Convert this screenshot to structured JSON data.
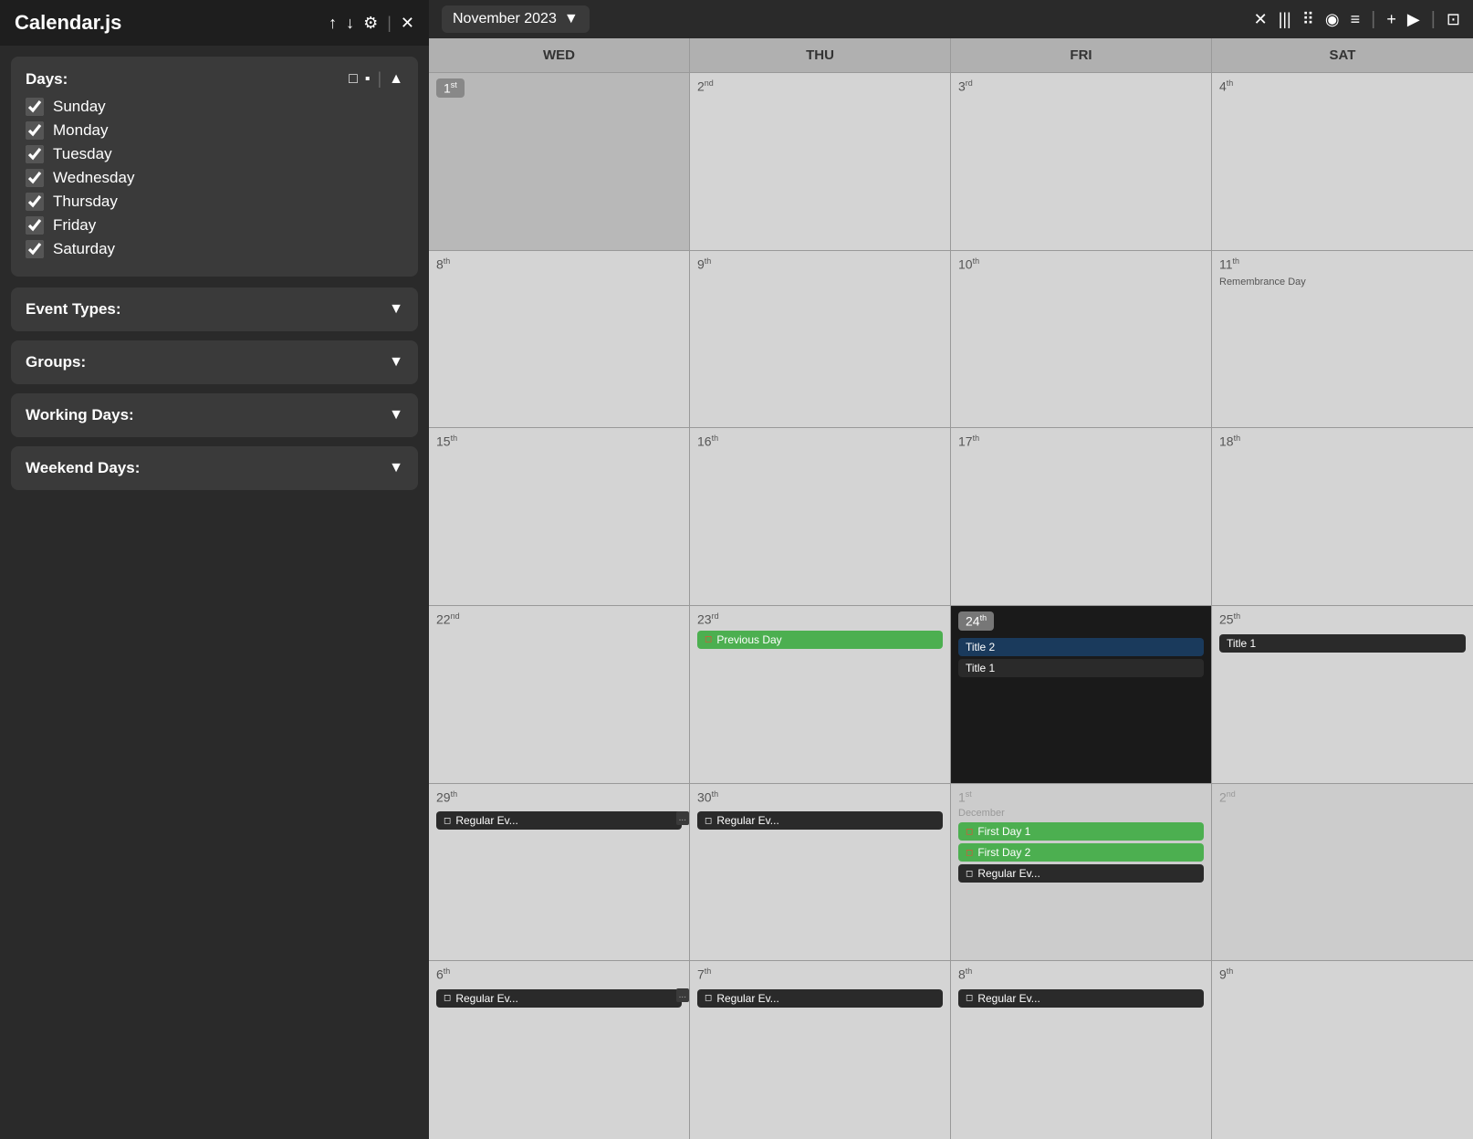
{
  "sidebar": {
    "title": "Calendar.js",
    "header_icons": [
      "↑",
      "↓",
      "⚙",
      "×"
    ],
    "days_label": "Days:",
    "days_view_icons": [
      "□",
      "▪",
      "▲"
    ],
    "days": [
      {
        "label": "Sunday",
        "checked": true
      },
      {
        "label": "Monday",
        "checked": true
      },
      {
        "label": "Tuesday",
        "checked": true
      },
      {
        "label": "Wednesday",
        "checked": true
      },
      {
        "label": "Thursday",
        "checked": true
      },
      {
        "label": "Friday",
        "checked": true
      },
      {
        "label": "Saturday",
        "checked": true
      }
    ],
    "collapsibles": [
      {
        "label": "Event Types:"
      },
      {
        "label": "Groups:"
      },
      {
        "label": "Working Days:"
      },
      {
        "label": "Weekend Days:"
      }
    ]
  },
  "toolbar": {
    "month_label": "November 2023",
    "month_dropdown": "▼",
    "icons": [
      "✕",
      "|||",
      "⠿",
      "◉",
      "≡",
      "|",
      "+",
      "▶",
      "|",
      "⊡"
    ]
  },
  "calendar": {
    "day_headers": [
      "WED",
      "THU",
      "FRI",
      "SAT"
    ],
    "rows": [
      {
        "cells": [
          {
            "date": "1",
            "sup": "st",
            "today_style": true,
            "other_month": false,
            "events": []
          },
          {
            "date": "2",
            "sup": "nd",
            "other_month": false,
            "events": []
          },
          {
            "date": "3",
            "sup": "rd",
            "other_month": false,
            "events": []
          },
          {
            "date": "4",
            "sup": "th",
            "other_month": false,
            "events": []
          }
        ]
      },
      {
        "cells": [
          {
            "date": "8",
            "sup": "th",
            "other_month": false,
            "events": []
          },
          {
            "date": "9",
            "sup": "th",
            "other_month": false,
            "events": []
          },
          {
            "date": "10",
            "sup": "th",
            "other_month": false,
            "events": []
          },
          {
            "date": "11",
            "sup": "th",
            "other_month": false,
            "holiday": "Remembrance Day",
            "events": []
          }
        ]
      },
      {
        "cells": [
          {
            "date": "15",
            "sup": "th",
            "other_month": false,
            "events": []
          },
          {
            "date": "16",
            "sup": "th",
            "other_month": false,
            "events": []
          },
          {
            "date": "17",
            "sup": "th",
            "other_month": false,
            "events": []
          },
          {
            "date": "18",
            "sup": "th",
            "other_month": false,
            "events": []
          }
        ]
      },
      {
        "cells": [
          {
            "date": "22",
            "sup": "nd",
            "other_month": false,
            "events": []
          },
          {
            "date": "23",
            "sup": "rd",
            "other_month": false,
            "events": [
              {
                "label": "Previous Day",
                "type": "green",
                "icon": "red",
                "icon_char": "◻"
              }
            ]
          },
          {
            "date": "24",
            "sup": "th",
            "is_today": true,
            "other_month": false,
            "events": [
              {
                "label": "Title 2",
                "type": "title2",
                "icon": null
              },
              {
                "label": "Title 1",
                "type": "dark",
                "icon": null
              }
            ]
          },
          {
            "date": "25",
            "sup": "th",
            "other_month": false,
            "events": [
              {
                "label": "Title 1",
                "type": "dark",
                "icon": null
              }
            ]
          }
        ]
      },
      {
        "cells": [
          {
            "date": "29",
            "sup": "th",
            "other_month": false,
            "has_left_overflow": true,
            "events": [
              {
                "label": "Regular Ev...",
                "type": "dark",
                "icon": "regular",
                "icon_char": "◻"
              }
            ]
          },
          {
            "date": "30",
            "sup": "th",
            "other_month": false,
            "events": [
              {
                "label": "Regular Ev...",
                "type": "dark",
                "icon": "regular",
                "icon_char": "◻"
              }
            ]
          },
          {
            "date": "1",
            "sup": "st",
            "other_month": true,
            "month_label": "December",
            "events": [
              {
                "label": "First Day 1",
                "type": "green",
                "icon": "red",
                "icon_char": "◻"
              },
              {
                "label": "First Day 2",
                "type": "green",
                "icon": "red",
                "icon_char": "◻"
              },
              {
                "label": "Regular Ev...",
                "type": "dark",
                "icon": "regular",
                "icon_char": "◻"
              }
            ]
          },
          {
            "date": "2",
            "sup": "nd",
            "other_month": true,
            "events": []
          }
        ]
      },
      {
        "cells": [
          {
            "date": "6",
            "sup": "th",
            "other_month": false,
            "has_left_overflow": true,
            "events": [
              {
                "label": "Regular Ev...",
                "type": "dark",
                "icon": "regular",
                "icon_char": "◻"
              }
            ]
          },
          {
            "date": "7",
            "sup": "th",
            "other_month": false,
            "events": [
              {
                "label": "Regular Ev...",
                "type": "dark",
                "icon": "regular",
                "icon_char": "◻"
              }
            ]
          },
          {
            "date": "8",
            "sup": "th",
            "other_month": false,
            "events": [
              {
                "label": "Regular Ev...",
                "type": "dark",
                "icon": "regular",
                "icon_char": "◻"
              }
            ]
          },
          {
            "date": "9",
            "sup": "th",
            "other_month": false,
            "events": []
          }
        ]
      }
    ]
  }
}
